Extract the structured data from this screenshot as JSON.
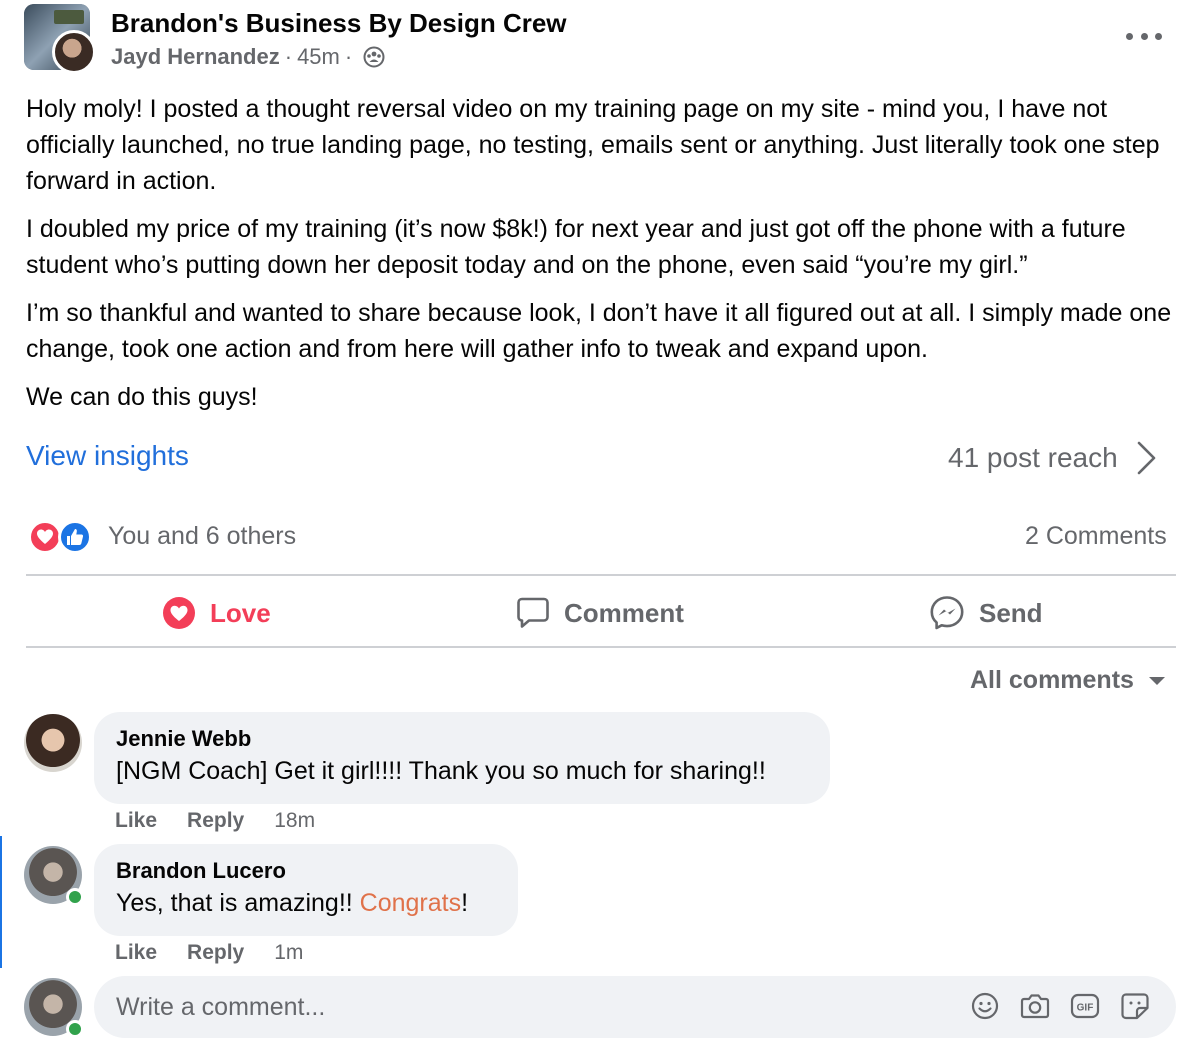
{
  "post": {
    "group_name": "Brandon's Business By Design Crew",
    "author": "Jayd Hernandez",
    "time": "45m",
    "paragraphs": [
      "Holy moly! I posted a thought reversal video on my training page on my site - mind you, I have not officially launched, no true landing page, no testing, emails sent or anything. Just literally took one step forward in action.",
      "I doubled my price of my training (it’s now $8k!) for next year and just got off the phone with a future student who’s putting down her deposit today and on the phone, even said “you’re my girl.”",
      "I’m so thankful and wanted to share because look, I don’t have it all figured out at all. I simply made one change, took one action and from here will gather info to tweak and expand upon.",
      "We can do this guys!"
    ],
    "view_insights": "View insights",
    "post_reach": "41 post reach",
    "reactions_text": "You and 6 others",
    "comments_count": "2 Comments"
  },
  "actions": {
    "love": "Love",
    "comment": "Comment",
    "send": "Send"
  },
  "comments_filter": "All comments",
  "comments": [
    {
      "name": "Jennie Webb",
      "text": "[NGM Coach] Get it girl!!!! Thank you so much for sharing!!",
      "like": "Like",
      "reply": "Reply",
      "time": "18m"
    },
    {
      "name": "Brandon Lucero",
      "text_before": "Yes, that is amazing!! ",
      "text_highlight": "Congrats",
      "text_after": "!",
      "like": "Like",
      "reply": "Reply",
      "time": "1m"
    }
  ],
  "composer": {
    "placeholder": "Write a comment...",
    "icons": [
      "emoji-icon",
      "camera-icon",
      "gif-icon",
      "sticker-icon"
    ]
  },
  "colors": {
    "link_blue": "#216fdb",
    "love_red": "#f33e58",
    "secondary_text": "#65676b",
    "bubble_bg": "#f0f2f5",
    "online_green": "#31a24c",
    "highlight_orange": "#e0724a"
  }
}
